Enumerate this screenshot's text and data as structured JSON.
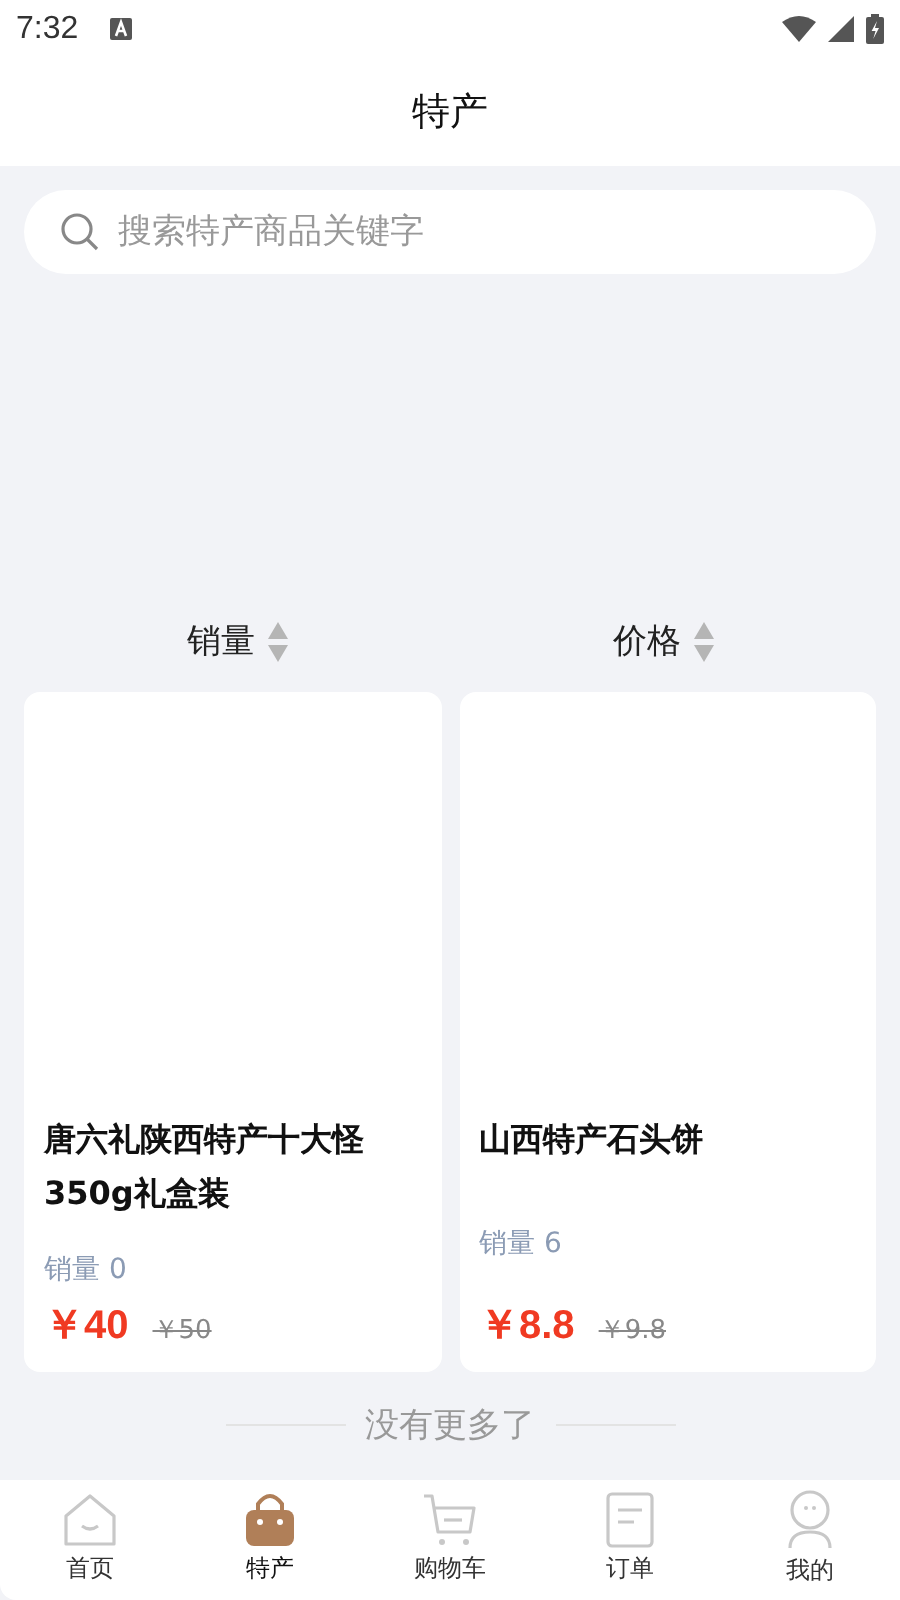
{
  "status_bar": {
    "time": "7:32"
  },
  "header": {
    "title": "特产"
  },
  "search": {
    "placeholder": "搜索特产商品关键字"
  },
  "sort_options": [
    {
      "label": "销量"
    },
    {
      "label": "价格"
    }
  ],
  "products": [
    {
      "name": "唐六礼陕西特产十大怪350g礼盒装",
      "sales": "销量 0",
      "price": "￥40",
      "original_price": "￥50"
    },
    {
      "name": "山西特产石头饼",
      "sales": "销量 6",
      "price": "￥8.8",
      "original_price": "￥9.8"
    }
  ],
  "end_note": "没有更多了",
  "tabs": [
    {
      "label": "首页",
      "selected": false
    },
    {
      "label": "特产",
      "selected": true
    },
    {
      "label": "购物车",
      "selected": false
    },
    {
      "label": "订单",
      "selected": false
    },
    {
      "label": "我的",
      "selected": false
    }
  ]
}
